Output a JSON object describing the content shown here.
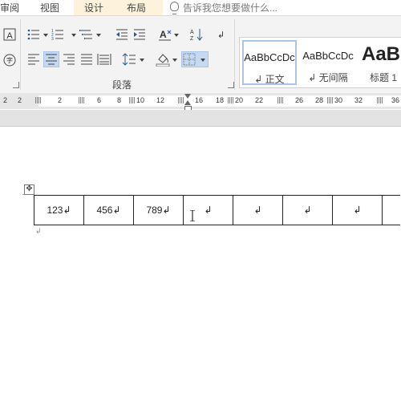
{
  "tabs": {
    "items": [
      {
        "label": "审阅"
      },
      {
        "label": "视图"
      },
      {
        "label": "设计"
      },
      {
        "label": "布局"
      }
    ],
    "tell_me": "告诉我您想要做什么..."
  },
  "ribbon": {
    "paragraph_group_label": "段落",
    "styles": [
      {
        "sample": "AaBbCcDc",
        "name": "↲ 正文"
      },
      {
        "sample": "AaBbCcDc",
        "name": "↲ 无间隔"
      },
      {
        "sample": "AaB",
        "name": "标题 1"
      }
    ],
    "ruler_numbers": [
      "2",
      "2",
      "6",
      "8",
      "10",
      "12",
      "16",
      "18",
      "20",
      "22",
      "26",
      "28",
      "30",
      "32",
      "36",
      "38"
    ]
  },
  "document": {
    "table": {
      "rows": [
        [
          "123↲",
          "456↲",
          "789↲",
          "↲",
          "↲",
          "↲",
          "↲",
          ""
        ]
      ]
    },
    "after_table_mark": "↲"
  }
}
